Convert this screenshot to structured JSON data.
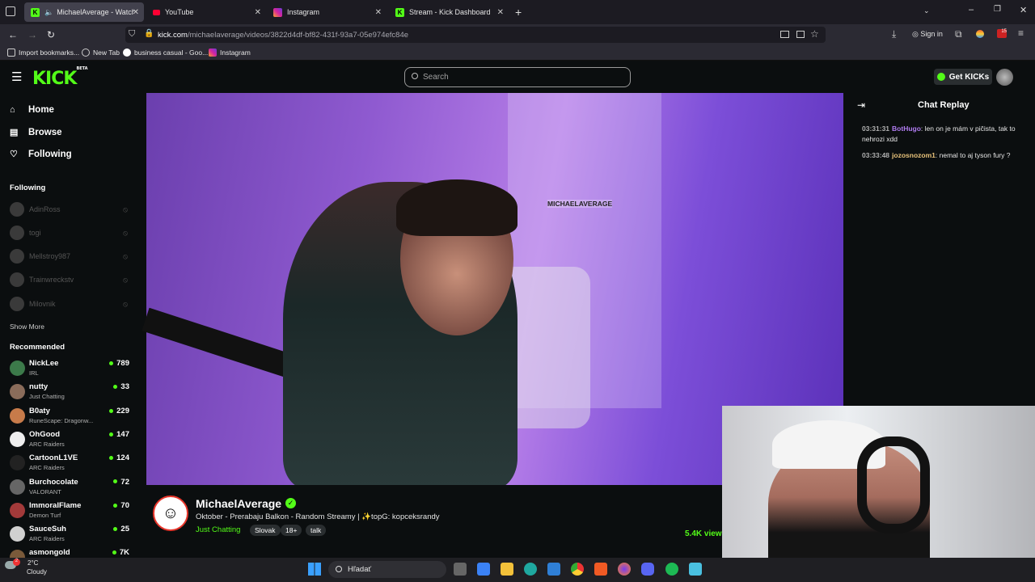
{
  "browser": {
    "tabs": [
      {
        "label": "MichaelAverage - Watch th",
        "icon": "kick-favicon",
        "active": true
      },
      {
        "label": "YouTube",
        "icon": "youtube-favicon"
      },
      {
        "label": "Instagram",
        "icon": "instagram-favicon"
      },
      {
        "label": "Stream - Kick Dashboard",
        "icon": "kick-favicon"
      }
    ],
    "url_host": "kick.com",
    "url_path": "/michaelaverage/videos/3822d4df-bf82-431f-93a7-05e974efc84e",
    "sign_in": "Sign in",
    "badge": "15",
    "bookmarks": [
      "Import bookmarks...",
      "New Tab",
      "business casual - Goo...",
      "Instagram"
    ]
  },
  "header": {
    "logo": "KICK",
    "logo_sup": "BETA",
    "search_placeholder": "Search",
    "get_kicks": "Get KICKs"
  },
  "sidebar": {
    "nav": [
      {
        "label": "Home",
        "icon": "home-icon"
      },
      {
        "label": "Browse",
        "icon": "browse-icon"
      },
      {
        "label": "Following",
        "icon": "heart-icon"
      }
    ],
    "following_title": "Following",
    "following": [
      "AdinRoss",
      "togi",
      "Mellstroy987",
      "Trainwreckstv",
      "Milovnik"
    ],
    "show_more": "Show More",
    "recommended_title": "Recommended",
    "recommended": [
      {
        "name": "NickLee",
        "cat": "IRL",
        "viewers": "789",
        "color": "#3c7a4a"
      },
      {
        "name": "nutty",
        "cat": "Just Chatting",
        "viewers": "33",
        "color": "#8a6c5a"
      },
      {
        "name": "B0aty",
        "cat": "RuneScape: Dragonw...",
        "viewers": "229",
        "color": "#c77b4a"
      },
      {
        "name": "OhGood",
        "cat": "ARC Raiders",
        "viewers": "147",
        "color": "#eeeeee"
      },
      {
        "name": "CartoonL1VE",
        "cat": "ARC Raiders",
        "viewers": "124",
        "color": "#222222"
      },
      {
        "name": "Burchocolate",
        "cat": "VALORANT",
        "viewers": "72",
        "color": "#666666"
      },
      {
        "name": "ImmoralFlame",
        "cat": "Demon Turf",
        "viewers": "70",
        "color": "#a33a3a"
      },
      {
        "name": "SauceSuh",
        "cat": "ARC Raiders",
        "viewers": "25",
        "color": "#d0d0d0"
      },
      {
        "name": "asmongold",
        "cat": "",
        "viewers": "7K",
        "color": "#7a5a3a"
      }
    ]
  },
  "video": {
    "overlay": "MICHAELAVERAGE"
  },
  "stream": {
    "channel": "MichaelAverage",
    "title": "Oktober  - Prerabaju Balkon - Random Streamy | ✨topG: kopceksrandy",
    "category": "Just Chatting",
    "tags": [
      "Slovak",
      "18+",
      "talk"
    ],
    "viewers": "5.4K view"
  },
  "chat": {
    "title": "Chat Replay",
    "messages": [
      {
        "time": "03:31:31",
        "user": "BotHugo",
        "color": "#b07cf0",
        "text": "len on je mám v pičista, tak to nehrozi xdd"
      },
      {
        "time": "03:33:48",
        "user": "jozosnozom1",
        "color": "#e8c27a",
        "text": "nemal to aj tyson fury ?"
      }
    ]
  },
  "taskbar": {
    "temp": "2°C",
    "weather": "Cloudy",
    "search": "Hľadať",
    "notif": "2"
  }
}
